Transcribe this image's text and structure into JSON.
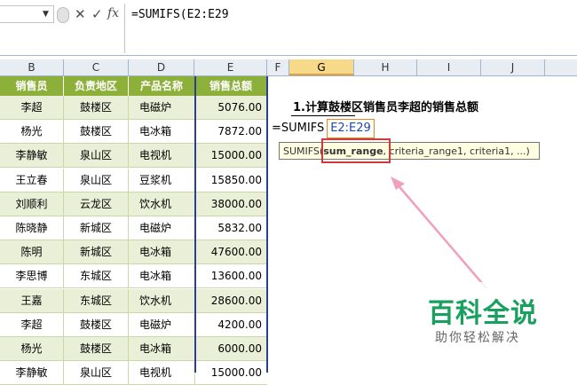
{
  "formula_bar": {
    "cancel_glyph": "✕",
    "enter_glyph": "✓",
    "fx_label": "fx",
    "formula": "=SUMIFS(E2:E29"
  },
  "columns": [
    "B",
    "C",
    "D",
    "E",
    "F",
    "G",
    "H",
    "I",
    "J"
  ],
  "selected_column": "G",
  "table": {
    "headers": [
      "销售员",
      "负责地区",
      "产品名称",
      "销售总额"
    ],
    "rows": [
      [
        "李超",
        "鼓楼区",
        "电磁炉",
        "5076.00"
      ],
      [
        "杨光",
        "鼓楼区",
        "电冰箱",
        "7872.00"
      ],
      [
        "李静敏",
        "泉山区",
        "电视机",
        "15000.00"
      ],
      [
        "王立春",
        "泉山区",
        "豆浆机",
        "15850.00"
      ],
      [
        "刘顺利",
        "云龙区",
        "饮水机",
        "38000.00"
      ],
      [
        "陈晓静",
        "新城区",
        "电磁炉",
        "5832.00"
      ],
      [
        "陈明",
        "新城区",
        "电冰箱",
        "47600.00"
      ],
      [
        "李思博",
        "东城区",
        "电冰箱",
        "13600.00"
      ],
      [
        "王嘉",
        "东城区",
        "饮水机",
        "28600.00"
      ],
      [
        "李超",
        "鼓楼区",
        "电磁炉",
        "4200.00"
      ],
      [
        "杨光",
        "鼓楼区",
        "电冰箱",
        "6000.00"
      ],
      [
        "李静敏",
        "泉山区",
        "电视机",
        "15000.00"
      ]
    ]
  },
  "task": {
    "title": "1.计算鼓楼区销售员李超的销售总额",
    "formula_prefix": "=SUMIFS",
    "formula_range": "E2:E29"
  },
  "tooltip": {
    "prefix": "SUMIFS(",
    "bold_arg": "sum_range",
    "rest": ", criteria_range1, criteria1, ...)"
  },
  "watermark": {
    "main": "百科全说",
    "sub": "助你轻松解决"
  },
  "colors": {
    "header_green": "#8cb03a",
    "band_green": "#eaf0d8",
    "highlight_red": "#d23a3a",
    "arrow_pink": "#f0a0b8",
    "brand_green": "#19a05e"
  }
}
